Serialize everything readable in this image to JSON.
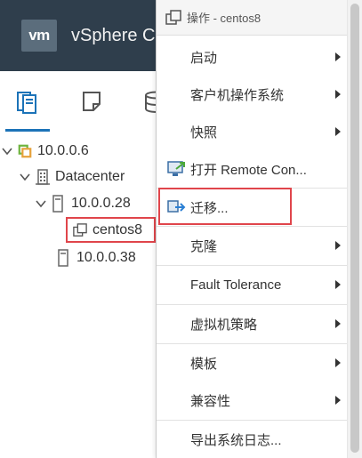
{
  "app": {
    "logo_text": "vm",
    "title": "vSphere C"
  },
  "left_tabs": [
    {
      "icon": "hosts-clusters-icon",
      "active": true
    },
    {
      "icon": "vms-templates-icon",
      "active": false
    },
    {
      "icon": "storage-icon",
      "active": false
    }
  ],
  "tree": [
    {
      "label": "10.0.0.6",
      "icon": "vcenter-icon",
      "expanded": true
    },
    {
      "label": "Datacenter",
      "icon": "datacenter-icon",
      "expanded": true
    },
    {
      "label": "10.0.0.28",
      "icon": "host-icon",
      "expanded": true
    },
    {
      "label": "centos8",
      "icon": "vm-icon",
      "selected": true
    },
    {
      "label": "10.0.0.38",
      "icon": "host-icon"
    }
  ],
  "context_menu": {
    "header": "操作 - centos8",
    "items": [
      {
        "label": "启动",
        "submenu": true
      },
      {
        "label": "客户机操作系统",
        "submenu": true
      },
      {
        "label": "快照",
        "submenu": true
      },
      {
        "label": "打开 Remote Con...",
        "icon": "remote-console-icon"
      },
      {
        "label": "迁移...",
        "icon": "migrate-icon",
        "highlighted": true
      },
      {
        "label": "克隆",
        "submenu": true
      },
      {
        "label": "Fault Tolerance",
        "submenu": true
      },
      {
        "label": "虚拟机策略",
        "submenu": true
      },
      {
        "label": "模板",
        "submenu": true
      },
      {
        "label": "兼容性",
        "submenu": true
      },
      {
        "label": "导出系统日志..."
      }
    ]
  },
  "colors": {
    "header_bg": "#2f3e4c",
    "accent": "#1c73b8",
    "highlight_border": "#e0454b",
    "vcenter_green": "#6fb43f"
  }
}
